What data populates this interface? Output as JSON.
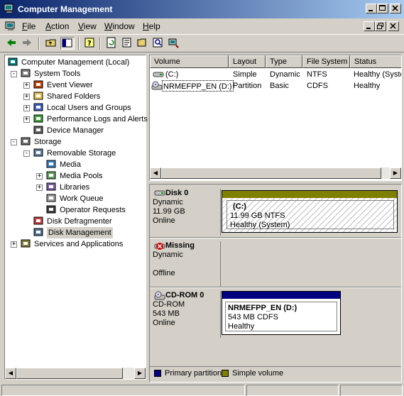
{
  "window": {
    "title": "Computer Management",
    "buttons": [
      "minimize",
      "maximize",
      "close"
    ]
  },
  "menu": {
    "items": [
      {
        "label": "File",
        "accel": "F"
      },
      {
        "label": "Action",
        "accel": "A"
      },
      {
        "label": "View",
        "accel": "V"
      },
      {
        "label": "Window",
        "accel": "W"
      },
      {
        "label": "Help",
        "accel": "H"
      }
    ]
  },
  "toolbar": {
    "buttons": [
      "back-icon",
      "forward-icon",
      "up-folder-icon",
      "show-hide-tree-icon",
      "help-icon",
      "refresh-icon",
      "properties-icon",
      "open-folder-icon",
      "search-icon",
      "connect-icon"
    ]
  },
  "tree": {
    "items": [
      {
        "label": "Computer Management (Local)",
        "level": 0,
        "expander": "",
        "icon": "computer-icon"
      },
      {
        "label": "System Tools",
        "level": 1,
        "expander": "-",
        "icon": "tools-icon"
      },
      {
        "label": "Event Viewer",
        "level": 2,
        "expander": "+",
        "icon": "event-viewer-icon"
      },
      {
        "label": "Shared Folders",
        "level": 2,
        "expander": "+",
        "icon": "shared-folder-icon"
      },
      {
        "label": "Local Users and Groups",
        "level": 2,
        "expander": "+",
        "icon": "users-icon"
      },
      {
        "label": "Performance Logs and Alerts",
        "level": 2,
        "expander": "+",
        "icon": "performance-icon"
      },
      {
        "label": "Device Manager",
        "level": 2,
        "expander": "",
        "icon": "device-manager-icon"
      },
      {
        "label": "Storage",
        "level": 1,
        "expander": "-",
        "icon": "storage-icon"
      },
      {
        "label": "Removable Storage",
        "level": 2,
        "expander": "-",
        "icon": "removable-storage-icon"
      },
      {
        "label": "Media",
        "level": 3,
        "expander": "",
        "icon": "media-icon"
      },
      {
        "label": "Media Pools",
        "level": 3,
        "expander": "+",
        "icon": "media-pools-icon"
      },
      {
        "label": "Libraries",
        "level": 3,
        "expander": "+",
        "icon": "libraries-icon"
      },
      {
        "label": "Work Queue",
        "level": 3,
        "expander": "",
        "icon": "work-queue-icon"
      },
      {
        "label": "Operator Requests",
        "level": 3,
        "expander": "",
        "icon": "operator-requests-icon"
      },
      {
        "label": "Disk Defragmenter",
        "level": 2,
        "expander": "",
        "icon": "defrag-icon"
      },
      {
        "label": "Disk Management",
        "level": 2,
        "expander": "",
        "icon": "disk-management-icon",
        "selected": true
      },
      {
        "label": "Services and Applications",
        "level": 1,
        "expander": "+",
        "icon": "services-icon"
      }
    ]
  },
  "volumes": {
    "columns": [
      "Volume",
      "Layout",
      "Type",
      "File System",
      "Status"
    ],
    "rows": [
      {
        "volume": "(C:)",
        "layout": "Simple",
        "type": "Dynamic",
        "fs": "NTFS",
        "status": "Healthy (System)",
        "icon": "hard-drive-icon"
      },
      {
        "volume": "NRMEFPP_EN (D:)",
        "layout": "Partition",
        "type": "Basic",
        "fs": "CDFS",
        "status": "Healthy",
        "icon": "cd-drive-icon"
      }
    ]
  },
  "disks": [
    {
      "name": "Disk 0",
      "kind": "Dynamic",
      "size": "11.99 GB",
      "state": "Online",
      "icon": "disk-icon",
      "partition": {
        "name": "(C:)",
        "detail": "11.99 GB NTFS",
        "status": "Healthy (System)",
        "bar_color": "#808000"
      }
    },
    {
      "name": "Missing",
      "kind": "Dynamic",
      "size": "",
      "state": "Offline",
      "icon": "missing-disk-icon"
    },
    {
      "name": "CD-ROM 0",
      "kind": "CD-ROM",
      "size": "543 MB",
      "state": "Online",
      "icon": "cdrom-icon",
      "partition": {
        "name": "NRMEFPP_EN  (D:)",
        "detail": "543 MB CDFS",
        "status": "Healthy",
        "bar_color": "#000080"
      }
    }
  ],
  "legend": [
    {
      "label": "Primary partition",
      "color": "#000080"
    },
    {
      "label": "Simple volume",
      "color": "#808000"
    }
  ]
}
